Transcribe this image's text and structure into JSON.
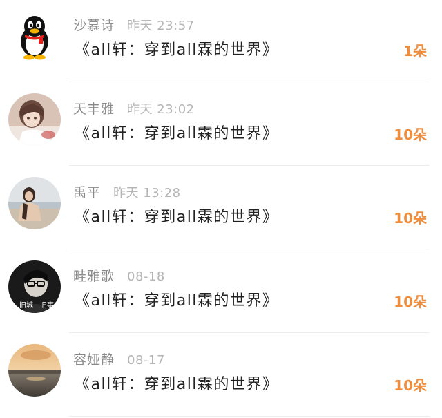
{
  "colors": {
    "accent": "#ef8d3c",
    "name_text": "#8a8a8a",
    "time_text": "#b5b5b5",
    "title_text": "#222222"
  },
  "items": [
    {
      "name": "沙慕诗",
      "time": "昨天 23:57",
      "title": "《all轩：穿到all霖的世界》",
      "count": "1朵",
      "avatar_icon": "qq-penguin-avatar"
    },
    {
      "name": "天丰雅",
      "time": "昨天 23:02",
      "title": "《all轩：穿到all霖的世界》",
      "count": "10朵",
      "avatar_icon": "anime-girl-avatar"
    },
    {
      "name": "禹平",
      "time": "昨天 13:28",
      "title": "《all轩：穿到all霖的世界》",
      "count": "10朵",
      "avatar_icon": "beach-girl-avatar"
    },
    {
      "name": "畦雅歌",
      "time": "08-18",
      "title": "《all轩：穿到all霖的世界》",
      "count": "10朵",
      "avatar_icon": "glasses-boy-avatar",
      "avatar_caption_left": "旧城",
      "avatar_caption_right": "旧事"
    },
    {
      "name": "容娅静",
      "time": "08-17",
      "title": "《all轩：穿到all霖的世界》",
      "count": "10朵",
      "avatar_icon": "sunset-lake-avatar"
    }
  ]
}
